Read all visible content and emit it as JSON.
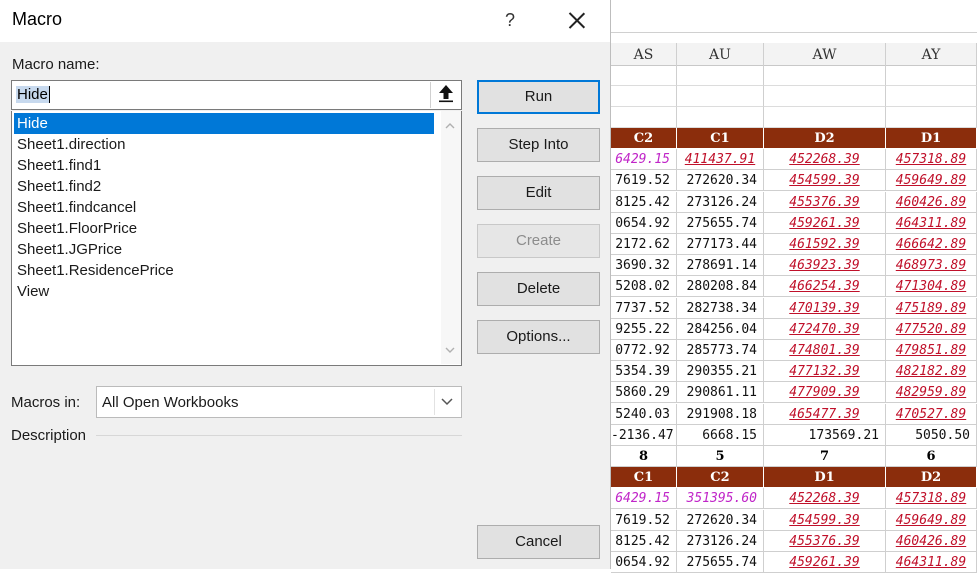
{
  "dialog": {
    "title": "Macro",
    "help_label": "?",
    "macro_name_label": "Macro name:",
    "macro_name_value": "Hide",
    "macros": [
      "Hide",
      "Sheet1.direction",
      "Sheet1.find1",
      "Sheet1.find2",
      "Sheet1.findcancel",
      "Sheet1.FloorPrice",
      "Sheet1.JGPrice",
      "Sheet1.ResidencePrice",
      "View"
    ],
    "selected_macro": "Hide",
    "macros_in_label": "Macros in:",
    "macros_in_value": "All Open Workbooks",
    "description_label": "Description",
    "buttons": {
      "run": "Run",
      "step_into": "Step Into",
      "edit": "Edit",
      "create": "Create",
      "delete": "Delete",
      "options": "Options...",
      "cancel": "Cancel"
    },
    "colors": {
      "accent": "#0078d7",
      "dialog_bg": "#f0f0f0"
    }
  },
  "sheet": {
    "columns": [
      "AS",
      "AU",
      "AW",
      "AY"
    ],
    "colors": {
      "header_fill": "#8b2d0c",
      "red_text": "#c0102a",
      "magenta_text": "#c025c8"
    },
    "rows": [
      {
        "type": "hdr",
        "cells": [
          "C2",
          "C1",
          "D2",
          "D1"
        ]
      },
      {
        "cells": [
          "6429.15",
          "411437.91",
          "452268.39",
          "457318.89"
        ],
        "styles": [
          "mag",
          "red",
          "red",
          "red"
        ]
      },
      {
        "cells": [
          "7619.52",
          "272620.34",
          "454599.39",
          "459649.89"
        ],
        "styles": [
          "num",
          "num",
          "red",
          "red"
        ]
      },
      {
        "cells": [
          "8125.42",
          "273126.24",
          "455376.39",
          "460426.89"
        ],
        "styles": [
          "num",
          "num",
          "red",
          "red"
        ]
      },
      {
        "cells": [
          "0654.92",
          "275655.74",
          "459261.39",
          "464311.89"
        ],
        "styles": [
          "num",
          "num",
          "red",
          "red"
        ]
      },
      {
        "cells": [
          "2172.62",
          "277173.44",
          "461592.39",
          "466642.89"
        ],
        "styles": [
          "num",
          "num",
          "red",
          "red"
        ]
      },
      {
        "cells": [
          "3690.32",
          "278691.14",
          "463923.39",
          "468973.89"
        ],
        "styles": [
          "num",
          "num",
          "red",
          "red"
        ]
      },
      {
        "cells": [
          "5208.02",
          "280208.84",
          "466254.39",
          "471304.89"
        ],
        "styles": [
          "num",
          "num",
          "red",
          "red"
        ]
      },
      {
        "cells": [
          "7737.52",
          "282738.34",
          "470139.39",
          "475189.89"
        ],
        "styles": [
          "num",
          "num",
          "red",
          "red"
        ]
      },
      {
        "cells": [
          "9255.22",
          "284256.04",
          "472470.39",
          "477520.89"
        ],
        "styles": [
          "num",
          "num",
          "red",
          "red"
        ]
      },
      {
        "cells": [
          "0772.92",
          "285773.74",
          "474801.39",
          "479851.89"
        ],
        "styles": [
          "num",
          "num",
          "red",
          "red"
        ]
      },
      {
        "cells": [
          "5354.39",
          "290355.21",
          "477132.39",
          "482182.89"
        ],
        "styles": [
          "num",
          "num",
          "red",
          "red"
        ]
      },
      {
        "cells": [
          "5860.29",
          "290861.11",
          "477909.39",
          "482959.89"
        ],
        "styles": [
          "num",
          "num",
          "red",
          "red"
        ]
      },
      {
        "cells": [
          "5240.03",
          "291908.18",
          "465477.39",
          "470527.89"
        ],
        "styles": [
          "num",
          "num",
          "red",
          "red"
        ]
      },
      {
        "cells": [
          "-2136.47",
          "6668.15",
          "173569.21",
          "5050.50"
        ],
        "styles": [
          "num",
          "num",
          "num",
          "num"
        ]
      },
      {
        "cells": [
          "8",
          "5",
          "7",
          "6"
        ],
        "styles": [
          "bold",
          "bold",
          "bold",
          "bold"
        ]
      },
      {
        "type": "hdr",
        "cells": [
          "C1",
          "C2",
          "D1",
          "D2"
        ]
      },
      {
        "cells": [
          "6429.15",
          "351395.60",
          "452268.39",
          "457318.89"
        ],
        "styles": [
          "mag",
          "mag",
          "red",
          "red"
        ]
      },
      {
        "cells": [
          "7619.52",
          "272620.34",
          "454599.39",
          "459649.89"
        ],
        "styles": [
          "num",
          "num",
          "red",
          "red"
        ]
      },
      {
        "cells": [
          "8125.42",
          "273126.24",
          "455376.39",
          "460426.89"
        ],
        "styles": [
          "num",
          "num",
          "red",
          "red"
        ]
      },
      {
        "cells": [
          "0654.92",
          "275655.74",
          "459261.39",
          "464311.89"
        ],
        "styles": [
          "num",
          "num",
          "red",
          "red"
        ]
      }
    ]
  }
}
